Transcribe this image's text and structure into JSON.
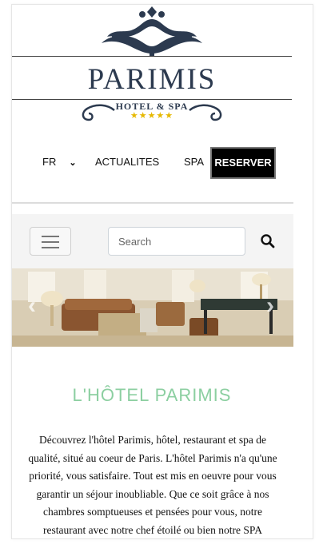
{
  "brand": {
    "name": "PARIMIS",
    "subtitle": "HOTEL & SPA",
    "stars": "★★★★★"
  },
  "nav": {
    "language": "FR",
    "items": [
      "ACTUALITES",
      "SPA"
    ],
    "reserve": "RESERVER"
  },
  "toolbar": {
    "search_placeholder": "Search"
  },
  "hero": {
    "prev": "‹",
    "next": "›"
  },
  "intro": {
    "title": "L'HÔTEL PARIMIS",
    "paragraph": "Découvrez l'hôtel Parimis, hôtel, restaurant et spa de qualité, situé au coeur de Paris. L'hôtel Parimis n'a qu'une priorité, vous satisfaire. Tout est mis en oeuvre pour vous garantir un séjour inoubliable. Que ce soit grâce à nos chambres somptueuses et pensées pour vous, notre restaurant avec notre chef étoilé ou bien notre SPA"
  },
  "colors": {
    "title_green": "#8ccfa1",
    "brand_navy": "#2c3a4f",
    "reserve_bg": "#000000",
    "star_gold": "#e6b800"
  }
}
